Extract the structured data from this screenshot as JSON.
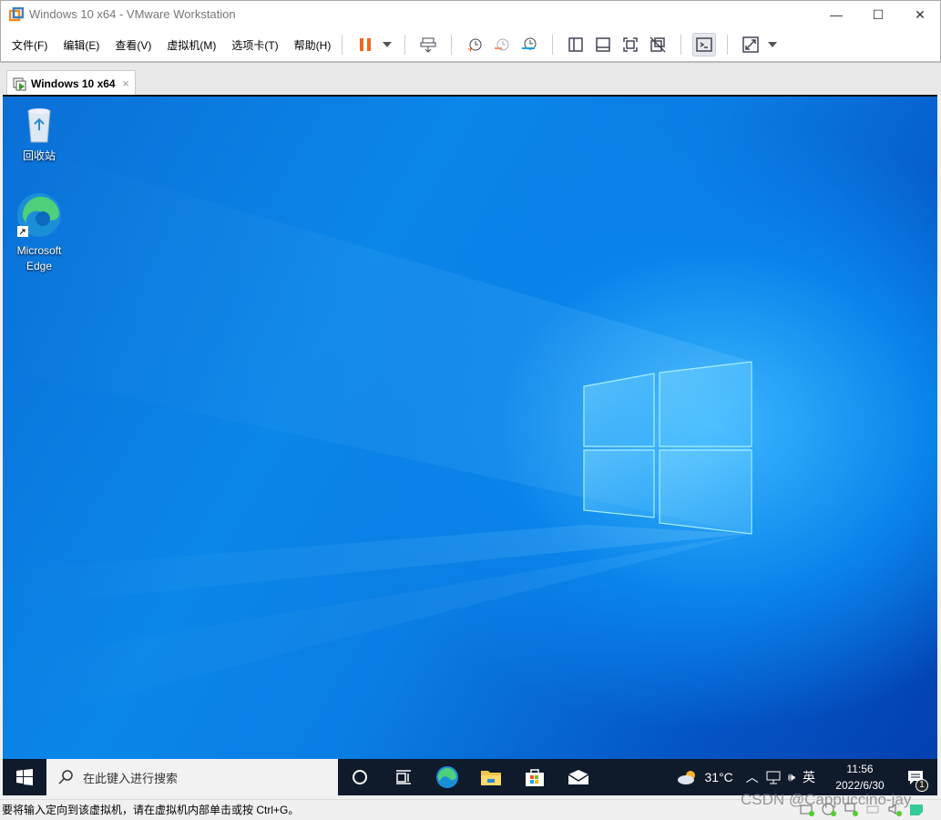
{
  "window": {
    "title": "Windows 10 x64 - VMware Workstation",
    "minimize": "—",
    "maximize": "☐",
    "close": "✕"
  },
  "menu": [
    "文件(F)",
    "编辑(E)",
    "查看(V)",
    "虚拟机(M)",
    "选项卡(T)",
    "帮助(H)"
  ],
  "tab": {
    "label": "Windows 10 x64",
    "close": "×"
  },
  "desktop": {
    "icons": [
      {
        "label": "回收站"
      },
      {
        "label": "Microsoft Edge"
      }
    ]
  },
  "taskbar": {
    "search_placeholder": "在此键入进行搜索",
    "weather": "31°C",
    "ime": "英",
    "time": "11:56",
    "date": "2022/6/30",
    "notifications": "1"
  },
  "statusbar": {
    "message": "要将输入定向到该虚拟机，请在虚拟机内部单击或按 Ctrl+G。"
  },
  "watermark": "CSDN @Cappuccino-jay",
  "colors": {
    "accent_orange": "#f26522",
    "desktop_blue": "#0a7de3",
    "taskbar": "#0f1a2a"
  }
}
